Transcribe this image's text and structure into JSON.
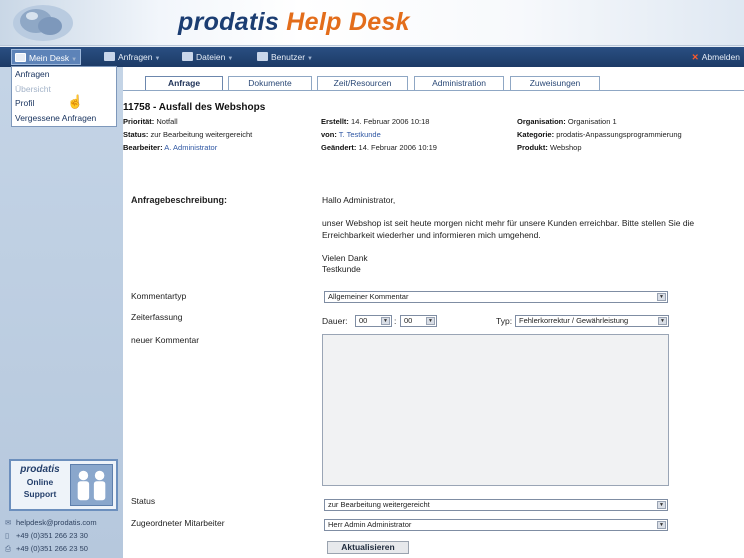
{
  "header": {
    "logo_part1": "prodatis",
    "logo_part2": "Help Desk"
  },
  "menubar": {
    "items": [
      {
        "label": "Mein Desk",
        "icon": "desk-icon"
      },
      {
        "label": "Anfragen",
        "icon": "requests-icon"
      },
      {
        "label": "Dateien",
        "icon": "files-icon"
      },
      {
        "label": "Benutzer",
        "icon": "users-icon"
      }
    ],
    "logout": "Abmelden"
  },
  "dropdown": {
    "items": [
      "Anfragen",
      "Übersicht",
      "Profil",
      "Vergessene Anfragen"
    ]
  },
  "tabs": [
    "Anfrage",
    "Dokumente",
    "Zeit/Resourcen",
    "Administration",
    "Zuweisungen"
  ],
  "ticket": {
    "title": "11758 - Ausfall des Webshops",
    "priority_label": "Priorität:",
    "priority": "Notfall",
    "status_label": "Status:",
    "status": "zur Bearbeitung weitergereicht",
    "editor_label": "Bearbeiter:",
    "editor": "A. Administrator",
    "created_label": "Erstellt:",
    "created": "14. Februar 2006 10:18",
    "from_label": "von:",
    "from": "T. Testkunde",
    "changed_label": "Geändert:",
    "changed": "14. Februar 2006 10:19",
    "org_label": "Organisation:",
    "org": "Organisation 1",
    "category_label": "Kategorie:",
    "category": "prodatis-Anpassungsprogrammierung",
    "product_label": "Produkt:",
    "product": "Webshop"
  },
  "description": {
    "label": "Anfragebeschreibung:",
    "greeting": "Hallo Administrator,",
    "body": "unser Webshop ist seit heute morgen nicht mehr für unsere Kunden erreichbar. Bitte stellen Sie die Erreichbarkeit wiederher und informieren mich umgehend.",
    "closing1": "Vielen Dank",
    "closing2": "Testkunde"
  },
  "form": {
    "comment_type_label": "Kommentartyp",
    "comment_type_value": "Allgemeiner Kommentar",
    "time_label": "Zeiterfassung",
    "duration_label": "Dauer:",
    "hours": "00",
    "minutes": "00",
    "time_sep": ":",
    "type_label": "Typ:",
    "type_value": "Fehlerkorrektur / Gewährleistung",
    "new_comment_label": "neuer Kommentar",
    "status_label": "Status",
    "status_value": "zur Bearbeitung weitergereicht",
    "assignee_label": "Zugeordneter Mitarbeiter",
    "assignee_value": "Herr Admin Administrator",
    "update_button": "Aktualisieren"
  },
  "support": {
    "brand": "prodatis",
    "line1": "Online",
    "line2": "Support",
    "email": "helpdesk@prodatis.com",
    "phone": "+49 (0)351 266 23 30",
    "fax": "+49 (0)351 266 23 50"
  },
  "colors": {
    "brand_blue": "#1b3d72",
    "brand_orange": "#e36d1b",
    "menubar": "#1c3a66"
  }
}
